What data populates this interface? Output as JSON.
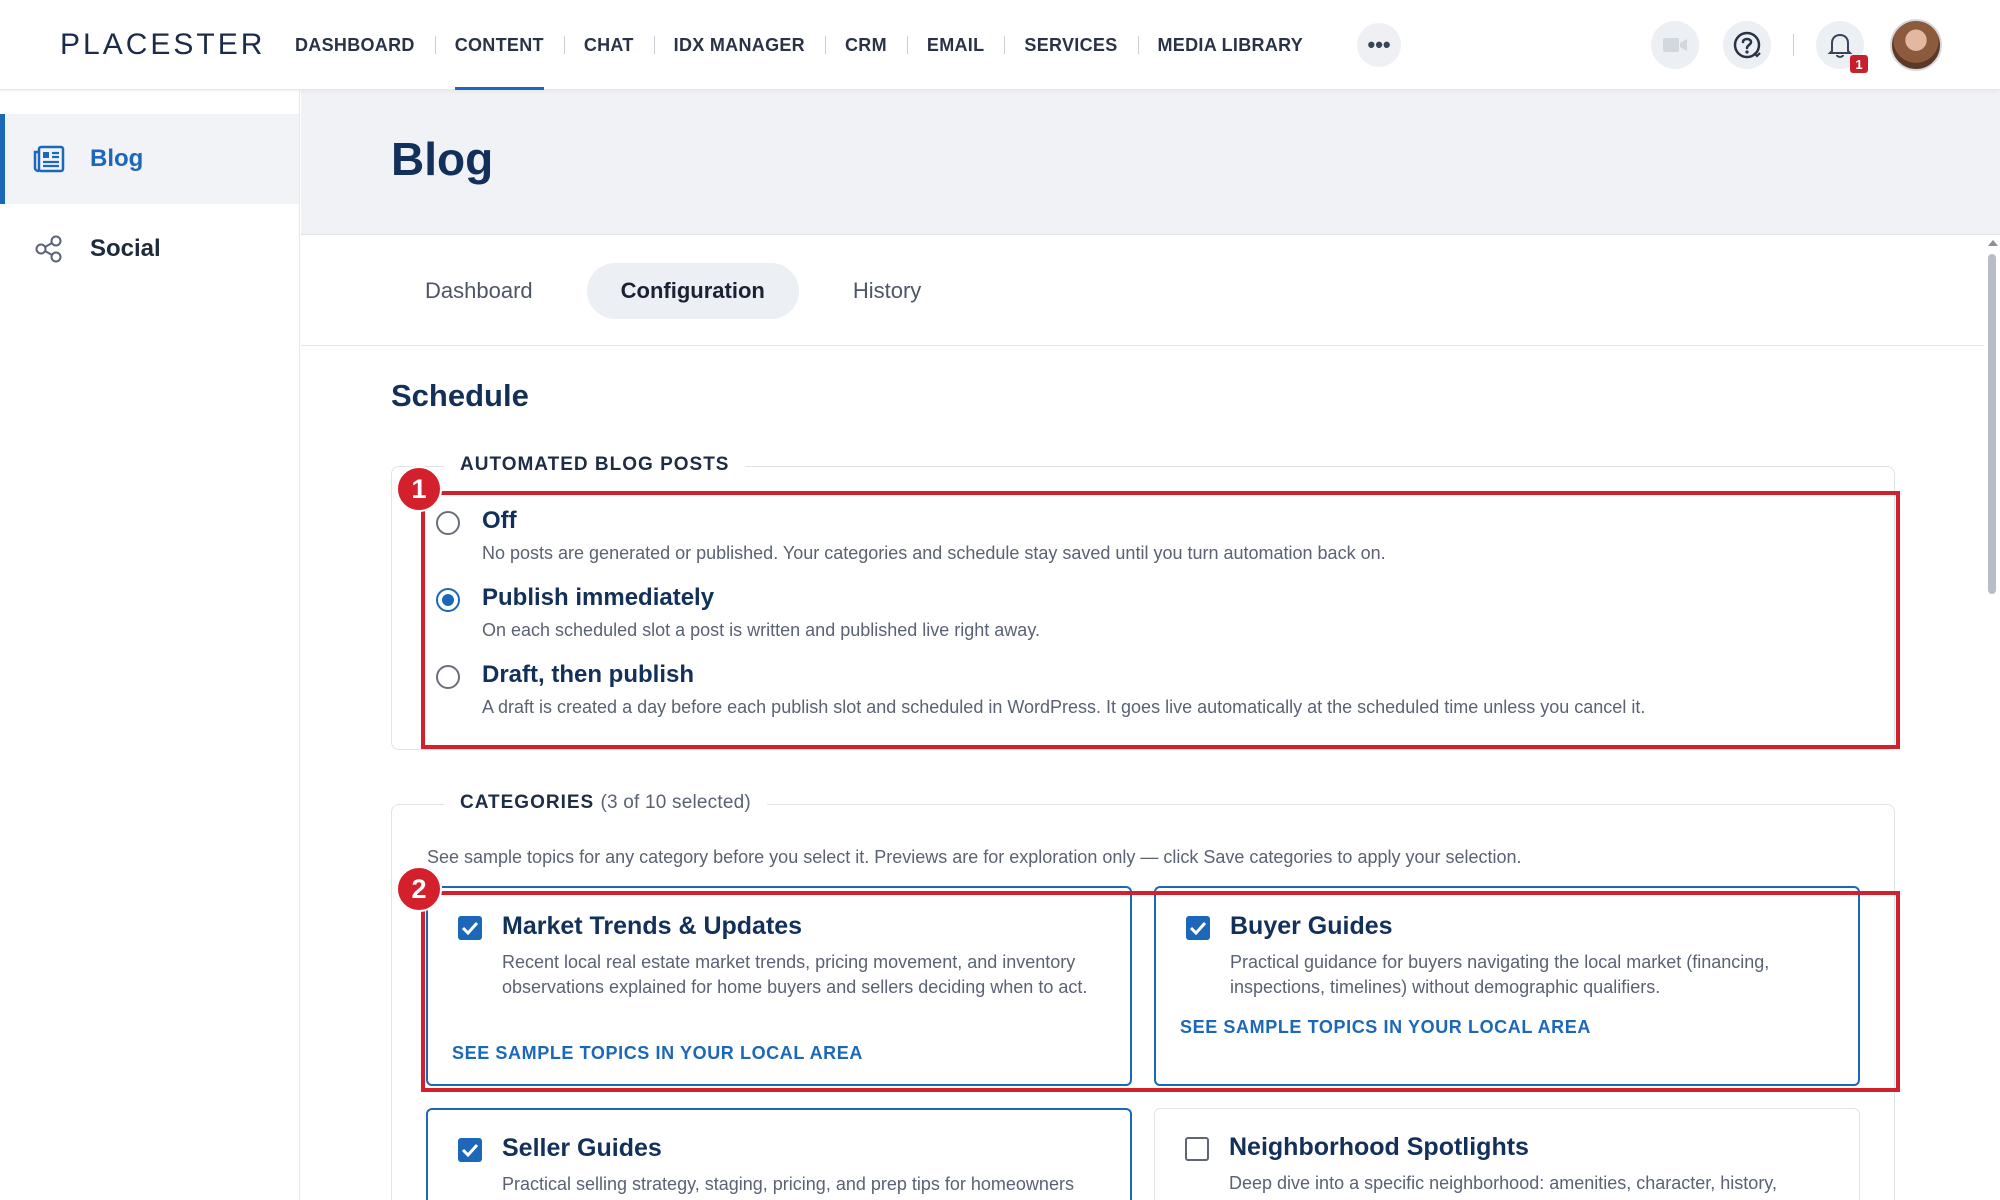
{
  "app": {
    "logo": "PLACESTER"
  },
  "nav": {
    "items": [
      {
        "label": "DASHBOARD"
      },
      {
        "label": "CONTENT"
      },
      {
        "label": "CHAT"
      },
      {
        "label": "IDX MANAGER"
      },
      {
        "label": "CRM"
      },
      {
        "label": "EMAIL"
      },
      {
        "label": "SERVICES"
      },
      {
        "label": "MEDIA LIBRARY"
      }
    ],
    "active": "CONTENT",
    "more_label": "•••",
    "notification_count": "1"
  },
  "sidebar": {
    "items": [
      {
        "label": "Blog",
        "icon": "newspaper-icon",
        "active": true
      },
      {
        "label": "Social",
        "icon": "share-icon",
        "active": false
      }
    ]
  },
  "page": {
    "title": "Blog"
  },
  "tabs": {
    "items": [
      {
        "label": "Dashboard"
      },
      {
        "label": "Configuration"
      },
      {
        "label": "History"
      }
    ],
    "active": "Configuration"
  },
  "schedule": {
    "title": "Schedule",
    "automated": {
      "legend": "AUTOMATED BLOG POSTS",
      "options": [
        {
          "label": "Off",
          "desc": "No posts are generated or published. Your categories and schedule stay saved until you turn automation back on.",
          "checked": false
        },
        {
          "label": "Publish immediately",
          "desc": "On each scheduled slot a post is written and published live right away.",
          "checked": true
        },
        {
          "label": "Draft, then publish",
          "desc": "A draft is created a day before each publish slot and scheduled in WordPress. It goes live automatically at the scheduled time unless you cancel it.",
          "checked": false
        }
      ]
    },
    "categories": {
      "legend": "CATEGORIES",
      "legend_note": "(3 of 10 selected)",
      "intro": "See sample topics for any category before you select it. Previews are for exploration only — click Save categories to apply your selection.",
      "items": [
        {
          "title": "Market Trends & Updates",
          "desc": "Recent local real estate market trends, pricing movement, and inventory observations explained for home buyers and sellers deciding when to act.",
          "link": "SEE SAMPLE TOPICS IN YOUR LOCAL AREA",
          "checked": true
        },
        {
          "title": "Buyer Guides",
          "desc": "Practical guidance for buyers navigating the local market (financing, inspections, timelines) without demographic qualifiers.",
          "link": "SEE SAMPLE TOPICS IN YOUR LOCAL AREA",
          "checked": true
        },
        {
          "title": "Seller Guides",
          "desc": "Practical selling strategy, staging, pricing, and prep tips for homeowners",
          "checked": true
        },
        {
          "title": "Neighborhood Spotlights",
          "desc": "Deep dive into a specific neighborhood: amenities, character, history,",
          "checked": false
        }
      ]
    }
  },
  "annotations": [
    {
      "number": "1"
    },
    {
      "number": "2"
    }
  ],
  "colors": {
    "accent": "#1d67b8",
    "annotation": "#d4202c",
    "heading": "#12305a"
  }
}
